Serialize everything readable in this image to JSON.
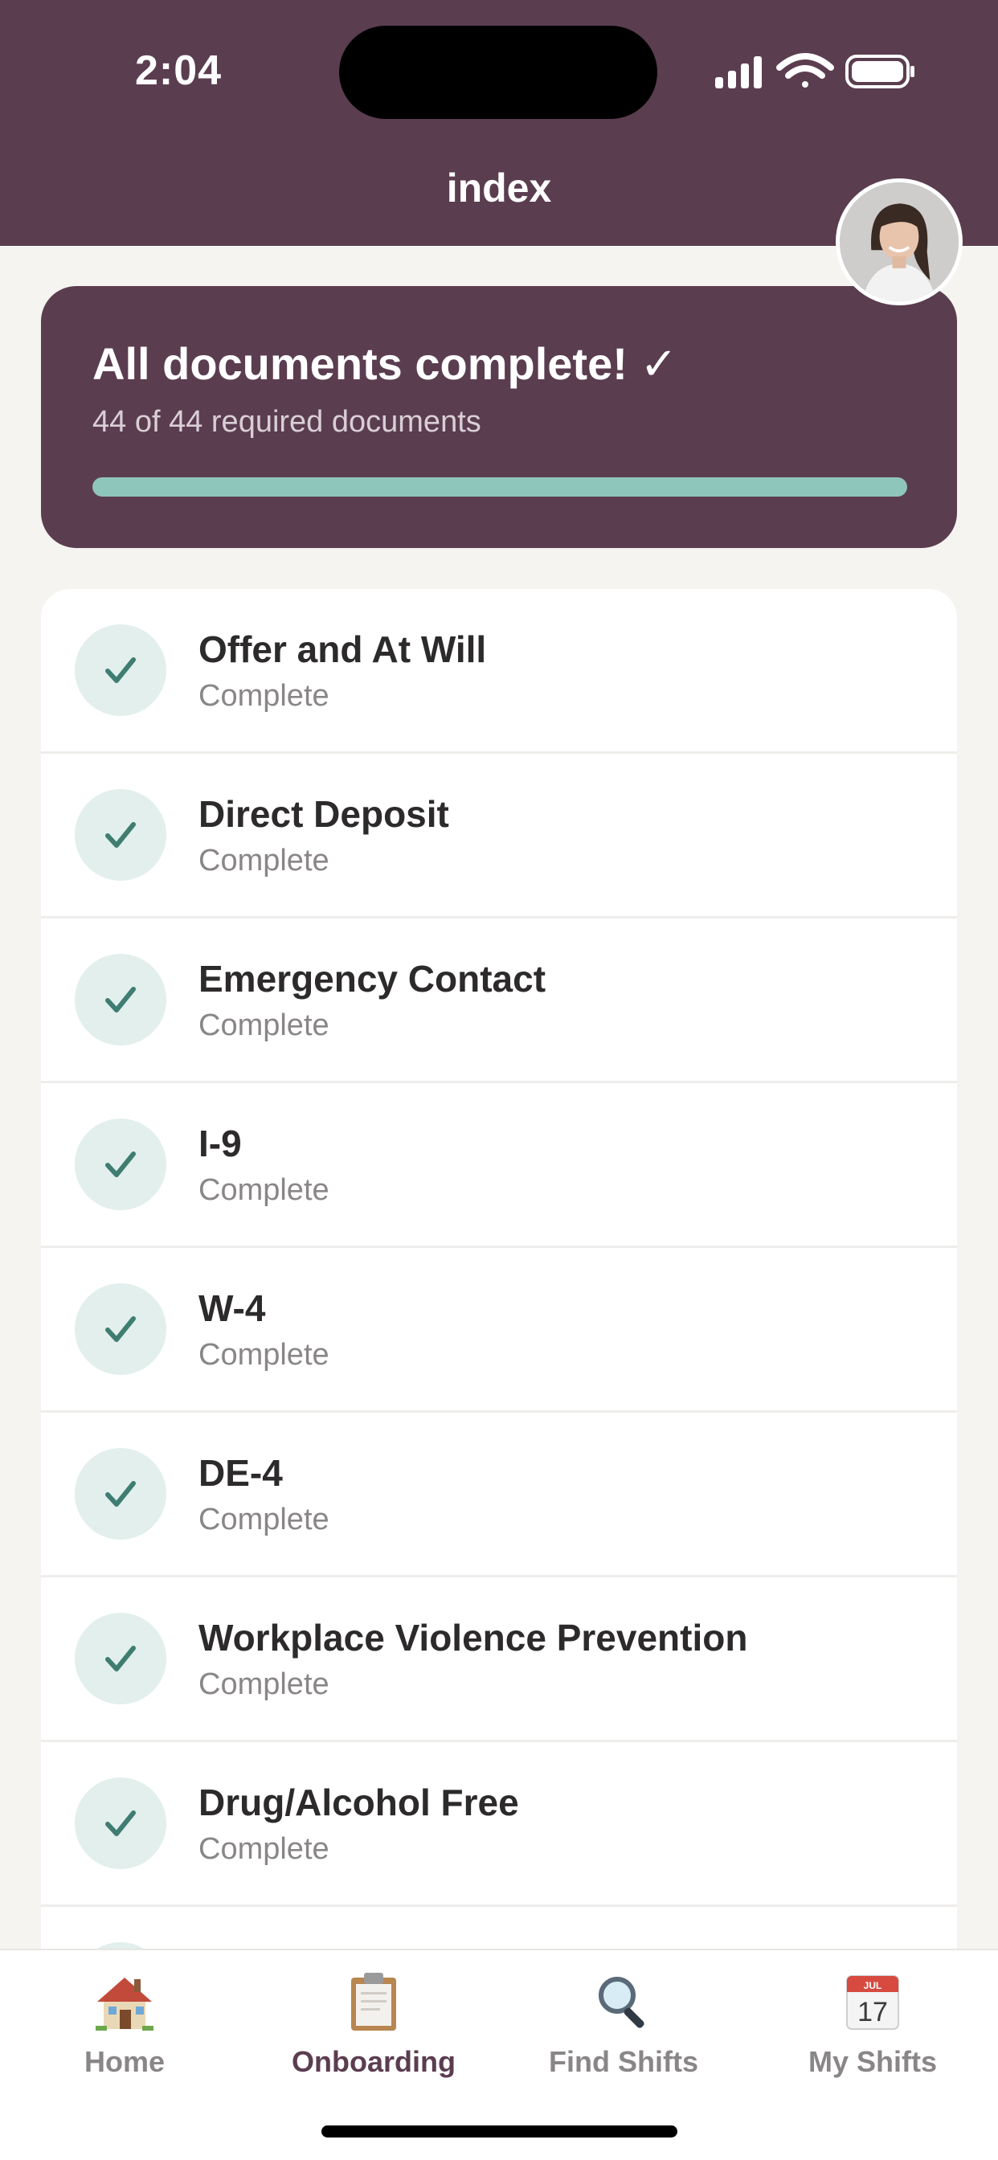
{
  "status_bar": {
    "time": "2:04"
  },
  "header": {
    "title": "index"
  },
  "summary": {
    "title": "All documents complete! ✓",
    "subtitle": "44 of 44 required documents",
    "progress": 1.0
  },
  "documents": [
    {
      "name": "Offer and At Will",
      "status": "Complete"
    },
    {
      "name": "Direct Deposit",
      "status": "Complete"
    },
    {
      "name": "Emergency Contact",
      "status": "Complete"
    },
    {
      "name": "I-9",
      "status": "Complete"
    },
    {
      "name": "W-4",
      "status": "Complete"
    },
    {
      "name": "DE-4",
      "status": "Complete"
    },
    {
      "name": "Workplace Violence Prevention",
      "status": "Complete"
    },
    {
      "name": "Drug/Alcohol Free",
      "status": "Complete"
    }
  ],
  "tabs": [
    {
      "label": "Home",
      "icon": "house-icon",
      "active": false
    },
    {
      "label": "Onboarding",
      "icon": "clipboard-icon",
      "active": true
    },
    {
      "label": "Find Shifts",
      "icon": "magnifier-icon",
      "active": false
    },
    {
      "label": "My Shifts",
      "icon": "calendar-icon",
      "active": false,
      "calendar_month": "JUL",
      "calendar_day": "17"
    }
  ],
  "colors": {
    "brand": "#5b3d50",
    "progress": "#8fc6bc",
    "check": "#3f7d72",
    "check_bg": "#e2efec"
  }
}
